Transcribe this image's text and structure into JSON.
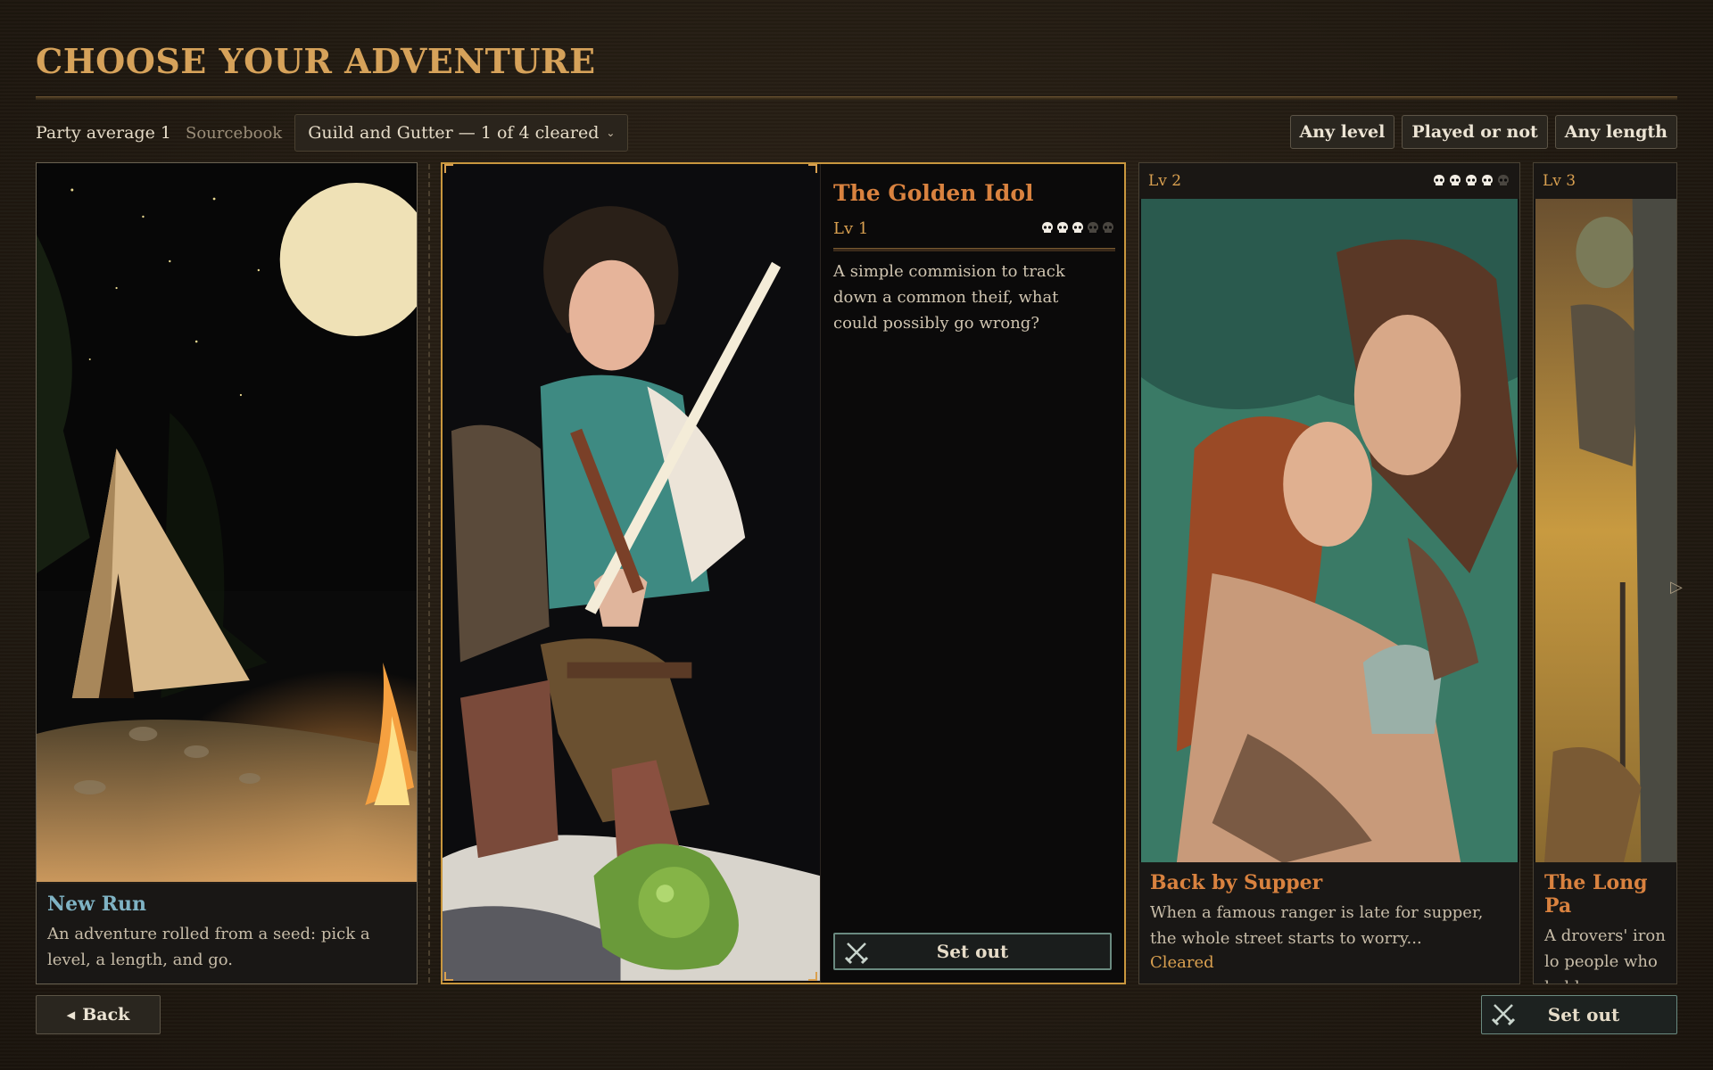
{
  "screen": {
    "title": "CHOOSE YOUR ADVENTURE"
  },
  "filters": {
    "party_average": "Party average 1",
    "sourcebook_label": "Sourcebook",
    "sourcebook_value": "Guild and Gutter — 1 of 4 cleared",
    "chips": [
      "Any level",
      "Played or not",
      "Any length"
    ]
  },
  "cards": {
    "new_run": {
      "name": "New Run",
      "description": "An adventure rolled from a seed: pick a level, a length, and go."
    },
    "golden_idol": {
      "name": "The Golden Idol",
      "level": "Lv 1",
      "difficulty": 3,
      "difficulty_max": 5,
      "description": "A simple commision to track down a common theif, what could possibly go wrong?",
      "action": "Set out"
    },
    "back_by_supper": {
      "name": "Back by Supper",
      "level": "Lv 2",
      "difficulty": 4,
      "difficulty_max": 5,
      "description": "When a famous ranger is late for supper, the whole street starts to worry...",
      "status": "Cleared"
    },
    "long_pass": {
      "name": "The Long Pa",
      "level": "Lv 3",
      "description": "A drovers' iron lo people who hold"
    }
  },
  "footer": {
    "back": "Back",
    "back_icon": "◂",
    "setout": "Set out"
  },
  "icons": {
    "skull": "skull-icon",
    "swords": "crossed-swords-icon",
    "next": "next-arrow-icon"
  },
  "colors": {
    "accent": "#d6a25a",
    "title_orange": "#d9823f",
    "selected_border": "#c9973e",
    "new_run_blue": "#7fb3c4"
  }
}
